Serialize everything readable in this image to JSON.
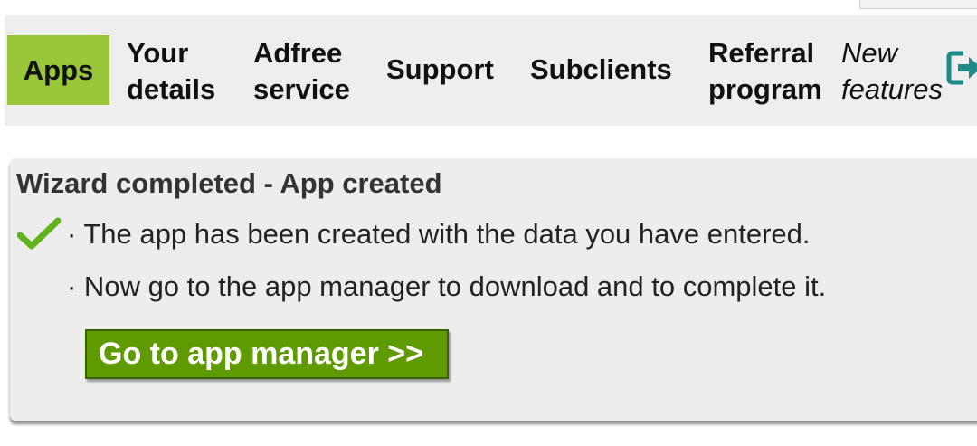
{
  "nav": {
    "items": [
      {
        "label": "Apps",
        "active": true
      },
      {
        "label_line1": "Your",
        "label_line2": "details"
      },
      {
        "label_line1": "Adfree",
        "label_line2": "service"
      },
      {
        "label": "Support"
      },
      {
        "label": "Subclients"
      },
      {
        "label_line1": "Referral",
        "label_line2": "program"
      },
      {
        "label_line1": "New",
        "label_line2": "features"
      }
    ],
    "exit_icon": "exit-icon"
  },
  "panel": {
    "title": "Wizard completed - App created",
    "line1": "· The app has been created with the data you have entered.",
    "line2": "· Now go to the app manager to download and to complete it.",
    "check_icon": "check-icon",
    "button_label": "Go to app manager >>"
  },
  "colors": {
    "active_tab": "#9ac63a",
    "button": "#5e9a00",
    "check": "#5fb31d",
    "exit_icon": "#1f8a87"
  }
}
